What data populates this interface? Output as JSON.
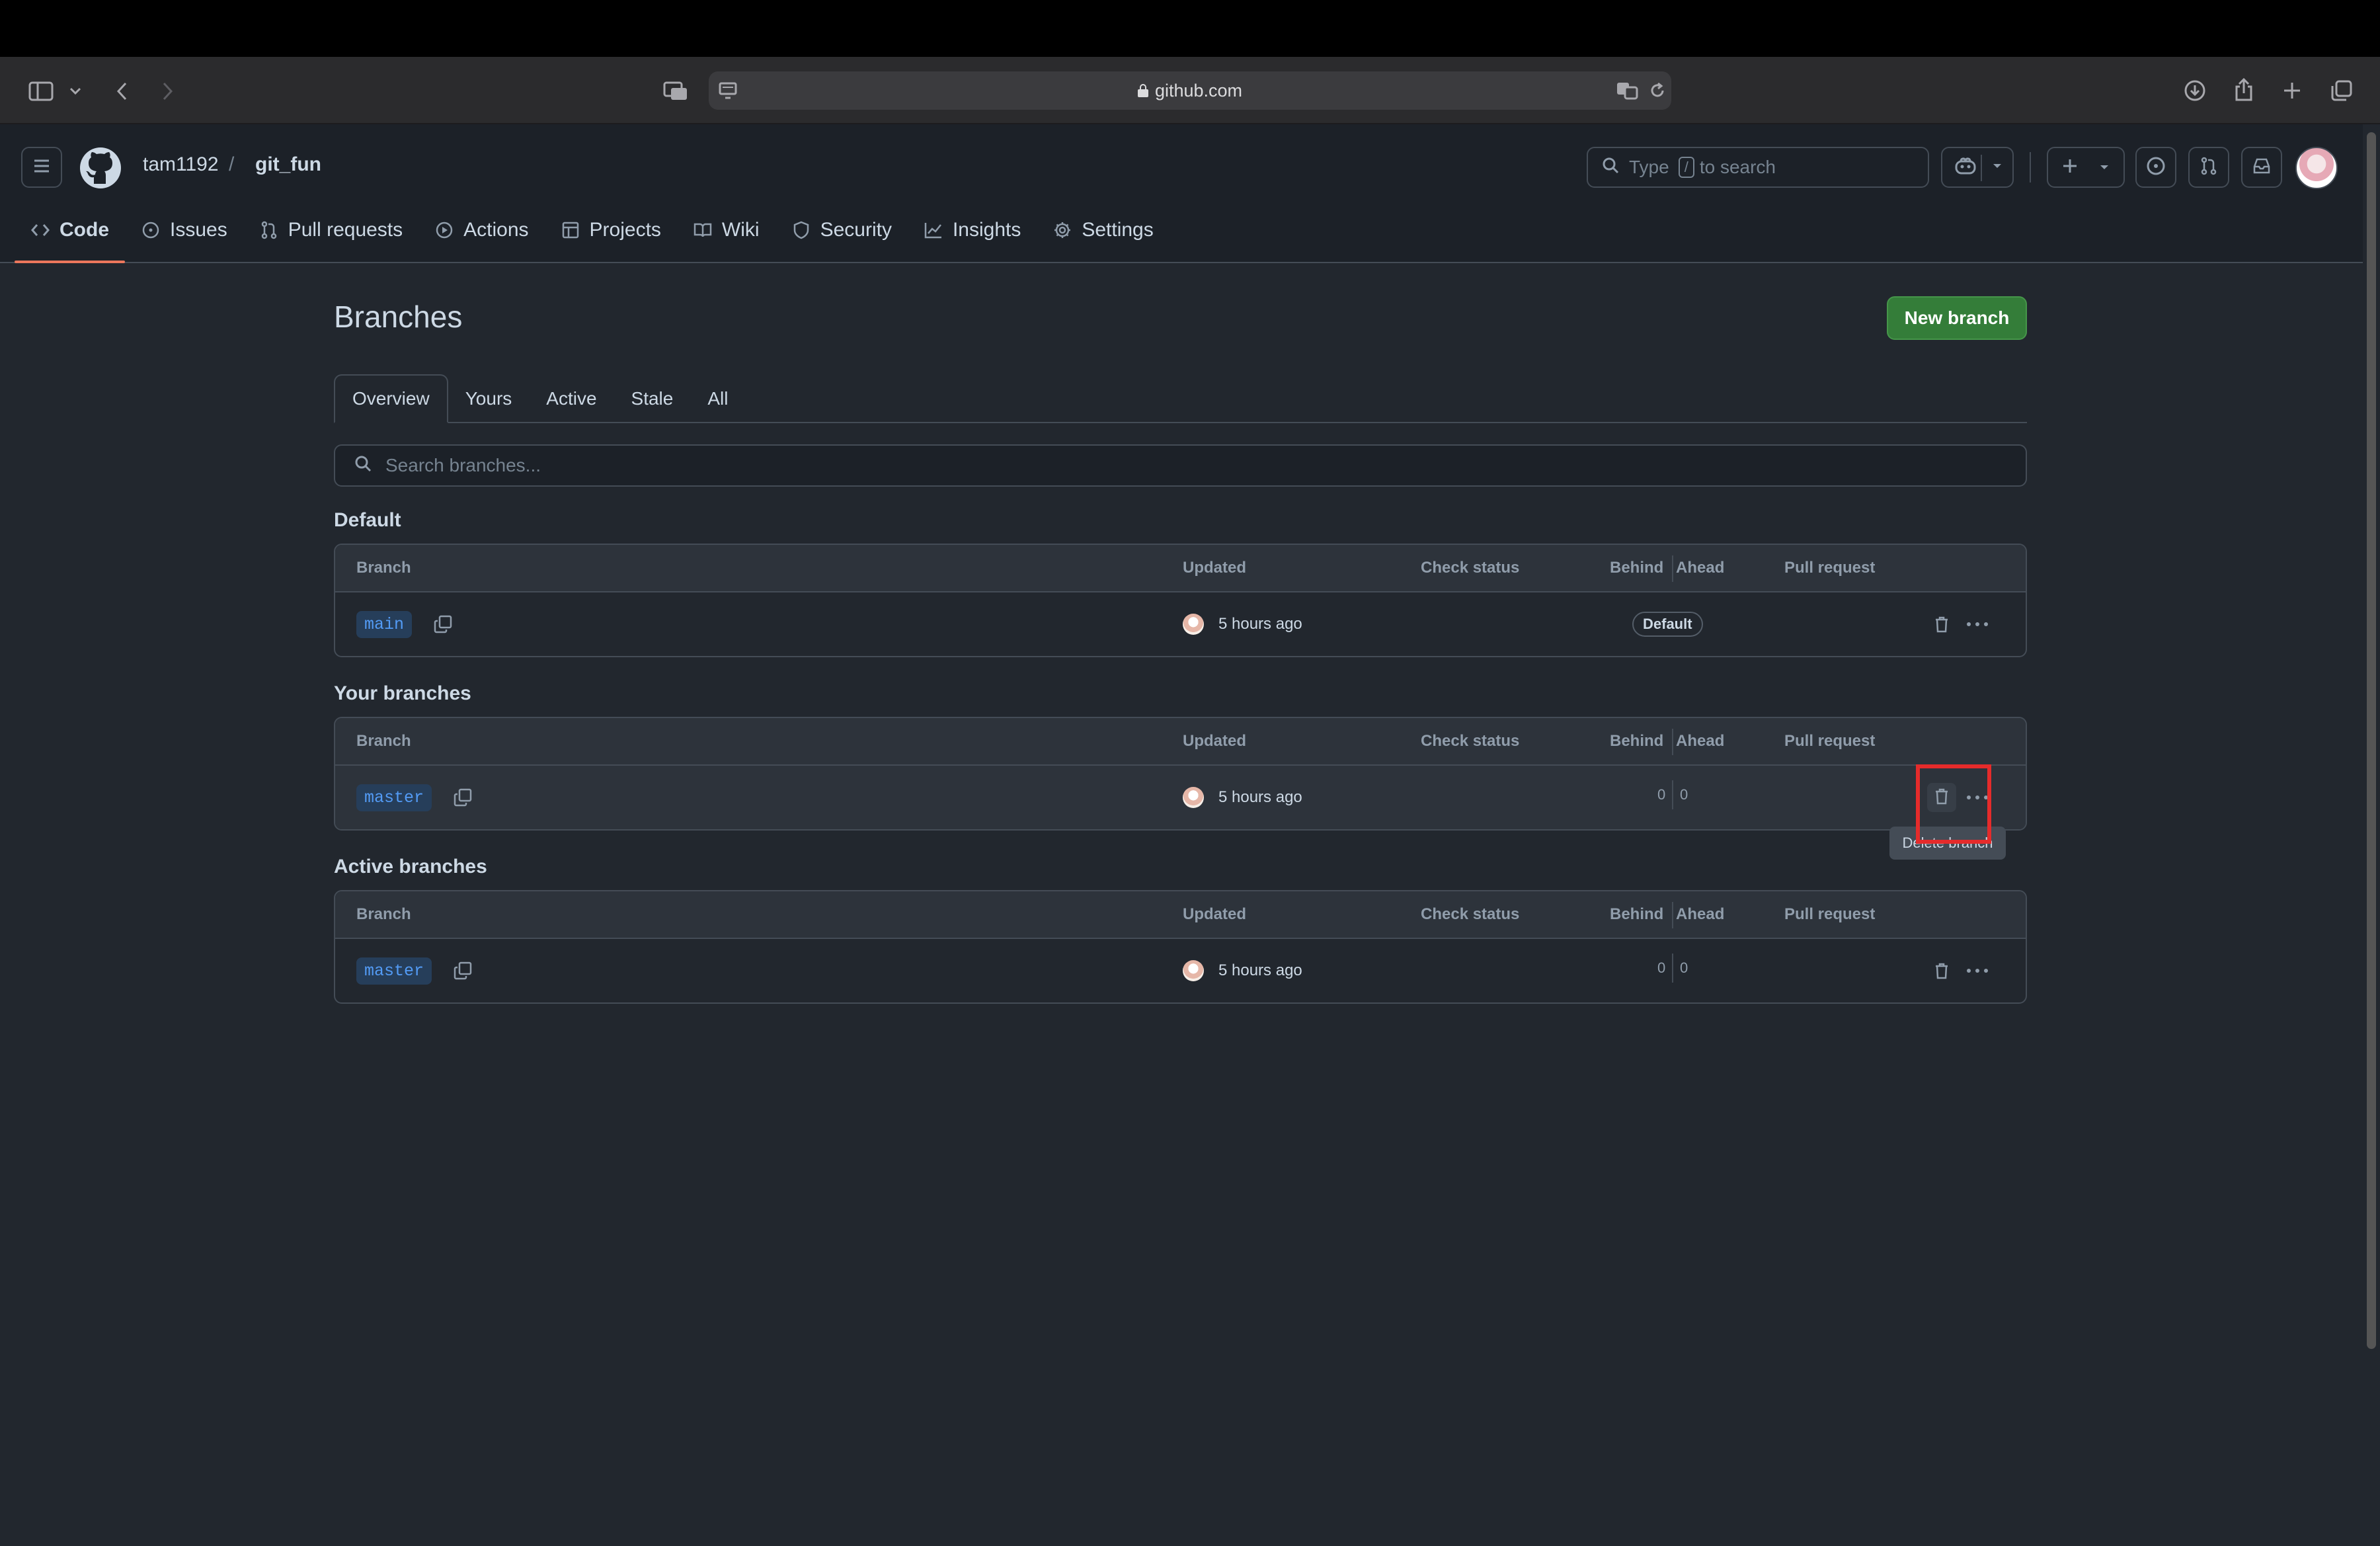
{
  "browser": {
    "url": "github.com"
  },
  "header": {
    "owner": "tam1192",
    "separator": "/",
    "repo": "git_fun",
    "search_placeholder_pre": "Type",
    "search_key": "/",
    "search_placeholder_post": "to search"
  },
  "nav": {
    "items": [
      {
        "label": "Code",
        "icon": "code-icon"
      },
      {
        "label": "Issues",
        "icon": "issue-icon"
      },
      {
        "label": "Pull requests",
        "icon": "pull-request-icon"
      },
      {
        "label": "Actions",
        "icon": "play-icon"
      },
      {
        "label": "Projects",
        "icon": "table-icon"
      },
      {
        "label": "Wiki",
        "icon": "book-icon"
      },
      {
        "label": "Security",
        "icon": "shield-icon"
      },
      {
        "label": "Insights",
        "icon": "graph-icon"
      },
      {
        "label": "Settings",
        "icon": "gear-icon"
      }
    ]
  },
  "page": {
    "title": "Branches",
    "new_branch_label": "New branch",
    "tabs": [
      "Overview",
      "Yours",
      "Active",
      "Stale",
      "All"
    ],
    "search_placeholder": "Search branches..."
  },
  "columns": {
    "branch": "Branch",
    "updated": "Updated",
    "check_status": "Check status",
    "behind": "Behind",
    "ahead": "Ahead",
    "pull_request": "Pull request"
  },
  "sections": {
    "default": {
      "title": "Default",
      "branch": "main",
      "updated": "5 hours ago",
      "badge": "Default"
    },
    "yours": {
      "title": "Your branches",
      "branch": "master",
      "updated": "5 hours ago",
      "behind": "0",
      "ahead": "0"
    },
    "active": {
      "title": "Active branches",
      "branch": "master",
      "updated": "5 hours ago",
      "behind": "0",
      "ahead": "0"
    }
  },
  "tooltip": {
    "text": "Delete branch"
  },
  "colors": {
    "accent": "#ec775c",
    "primary_button": "#347d39",
    "highlight": "#e52b2b"
  }
}
